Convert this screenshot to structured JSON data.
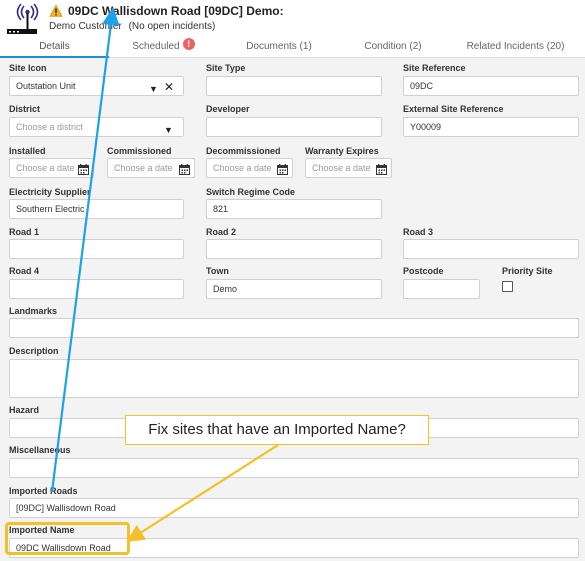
{
  "header": {
    "title": "09DC Wallisdown Road [09DC] Demo:",
    "customer": "Demo Customer",
    "incidents": "(No open incidents)",
    "site_icon": "radio-mast-icon",
    "warning_icon": "warning-triangle-icon"
  },
  "tabs": [
    {
      "label": "Details"
    },
    {
      "label": "Scheduled",
      "badge": "!"
    },
    {
      "label": "Documents (1)"
    },
    {
      "label": "Condition (2)"
    },
    {
      "label": "Related Incidents (20)"
    }
  ],
  "fields": {
    "site_icon": {
      "label": "Site Icon",
      "value": "Outstation Unit"
    },
    "site_type": {
      "label": "Site Type",
      "value": ""
    },
    "site_reference": {
      "label": "Site Reference",
      "value": "09DC"
    },
    "district": {
      "label": "District",
      "placeholder": "Choose a district"
    },
    "developer": {
      "label": "Developer",
      "value": ""
    },
    "external_site_reference": {
      "label": "External Site Reference",
      "value": "Y00009"
    },
    "installed": {
      "label": "Installed",
      "placeholder": "Choose a date"
    },
    "commissioned": {
      "label": "Commissioned",
      "placeholder": "Choose a date"
    },
    "decommissioned": {
      "label": "Decommissioned",
      "placeholder": "Choose a date"
    },
    "warranty_expires": {
      "label": "Warranty Expires",
      "placeholder": "Choose a date"
    },
    "electricity_supplier": {
      "label": "Electricity Supplier",
      "value": "Southern Electric"
    },
    "switch_regime_code": {
      "label": "Switch Regime Code",
      "value": "821"
    },
    "road1": {
      "label": "Road 1",
      "value": ""
    },
    "road2": {
      "label": "Road 2",
      "value": ""
    },
    "road3": {
      "label": "Road 3",
      "value": ""
    },
    "road4": {
      "label": "Road 4",
      "value": ""
    },
    "town": {
      "label": "Town",
      "value": "Demo"
    },
    "postcode": {
      "label": "Postcode",
      "value": ""
    },
    "priority_site": {
      "label": "Priority Site",
      "checked": false
    },
    "landmarks": {
      "label": "Landmarks",
      "value": ""
    },
    "description": {
      "label": "Description",
      "value": ""
    },
    "hazard": {
      "label": "Hazard",
      "value": ""
    },
    "miscellaneous": {
      "label": "Miscellaneous",
      "value": ""
    },
    "imported_roads": {
      "label": "Imported Roads",
      "value": "[09DC] Wallisdown Road"
    },
    "imported_name": {
      "label": "Imported Name",
      "value": "09DC Wallisdown Road"
    }
  },
  "annotation": {
    "callout_text": "Fix sites that have an Imported Name?",
    "arrow_blue": "#1aa3e6",
    "arrow_yellow": "#f2c028"
  },
  "colors": {
    "accent": "#1e8fd6",
    "badge": "#e8645f",
    "warning": "#f0b429"
  }
}
